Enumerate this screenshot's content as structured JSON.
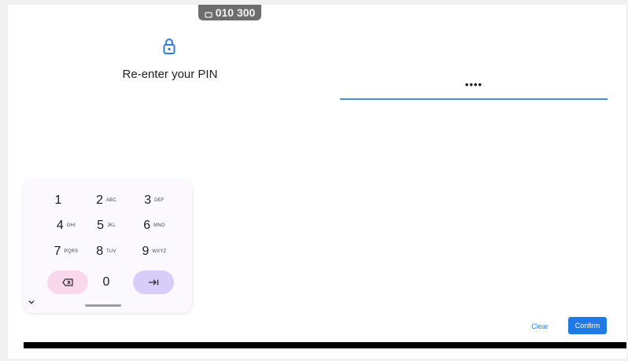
{
  "toast": {
    "text": "010 300"
  },
  "title": "Re-enter your PIN",
  "pin_field": {
    "value": "••••"
  },
  "keypad": {
    "keys": [
      {
        "digit": "1",
        "letters": ""
      },
      {
        "digit": "2",
        "letters": "ABC"
      },
      {
        "digit": "3",
        "letters": "DEF"
      },
      {
        "digit": "4",
        "letters": "GHI"
      },
      {
        "digit": "5",
        "letters": "JKL"
      },
      {
        "digit": "6",
        "letters": "MNO"
      },
      {
        "digit": "7",
        "letters": "PQRS"
      },
      {
        "digit": "8",
        "letters": "TUV"
      },
      {
        "digit": "9",
        "letters": "WXYZ"
      },
      {
        "digit": "0",
        "letters": ""
      }
    ],
    "backspace_icon": "backspace-icon",
    "next_icon": "tab-next-icon",
    "collapse_icon": "chevron-down-icon"
  },
  "actions": {
    "clear": "Clear",
    "confirm": "Confirm"
  },
  "colors": {
    "accent": "#1f7ae6",
    "underline": "#4a90d9",
    "delete_key": "#f9d8ee",
    "next_key": "#d8ccf8"
  }
}
